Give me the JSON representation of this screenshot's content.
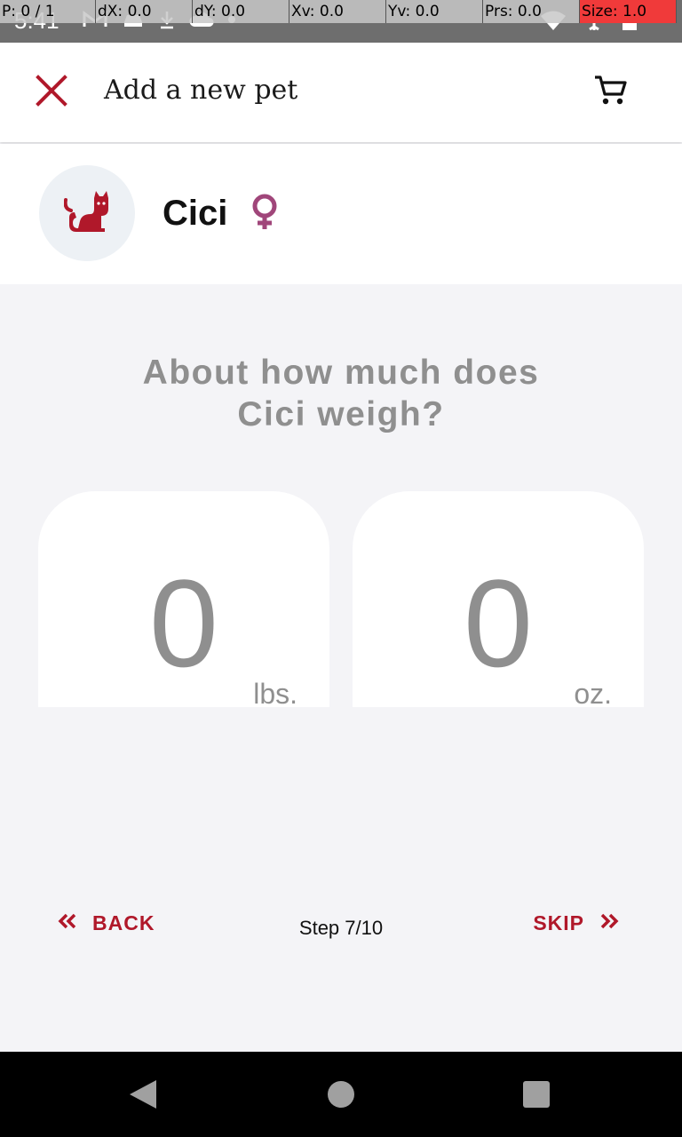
{
  "status_bar": {
    "time": "5:41"
  },
  "debug_overlay": {
    "pointer": "P: 0 / 1",
    "dx": "dX: 0.0",
    "dy": "dY: 0.0",
    "xv": "Xv: 0.0",
    "yv": "Yv: 0.0",
    "prs": "Prs: 0.0",
    "size": "Size: 1.0"
  },
  "app_bar": {
    "title": "Add a new pet",
    "close_icon": "close-icon",
    "cart_icon": "cart-icon"
  },
  "pet": {
    "name": "Cici",
    "avatar_icon": "cat-icon",
    "gender_icon": "female-icon"
  },
  "question": {
    "line1": "About how much does",
    "line2": "Cici weigh?"
  },
  "weight": {
    "pounds_value": "0",
    "pounds_unit": "lbs.",
    "ounces_value": "0",
    "ounces_unit": "oz."
  },
  "footer": {
    "back_label": "BACK",
    "step_label": "Step 7/10",
    "skip_label": "SKIP"
  },
  "colors": {
    "accent": "#b0182a",
    "female": "#a0467a",
    "muted_text": "#8f8f8f",
    "background": "#f4f4f7"
  }
}
